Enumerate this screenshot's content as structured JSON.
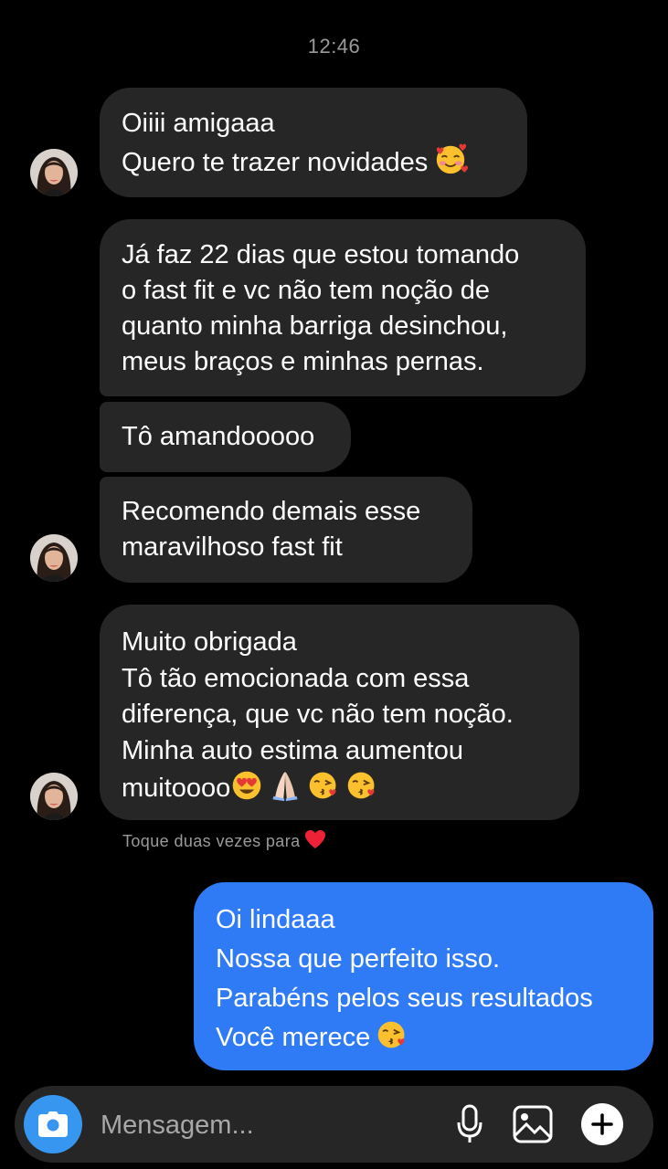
{
  "header": {
    "timestamp": "12:46"
  },
  "messages": [
    {
      "lines": [
        "Oiiii amigaaa",
        "Quero te trazer novidades"
      ],
      "emoji": "smiling-face-with-hearts"
    },
    {
      "lines": [
        "Já faz 22 dias que estou tomando",
        "o fast fit e vc não tem noção de",
        "quanto minha barriga desinchou,",
        "meus braços e minhas pernas."
      ]
    },
    {
      "lines": [
        "Tô amandooooo"
      ]
    },
    {
      "lines": [
        "Recomendo demais esse",
        "maravilhoso fast fit"
      ]
    },
    {
      "lines": [
        "Muito obrigada",
        "Tô tão emocionada com essa",
        "diferença, que vc não tem noção.",
        "Minha auto estima aumentou",
        "muitoooo"
      ],
      "emoji": [
        "heart-eyes",
        "folded-hands",
        "face-blowing-kiss",
        "face-blowing-kiss"
      ]
    },
    {
      "lines": [
        "Oi lindaaa",
        "Nossa que perfeito isso.",
        "Parabéns pelos seus resultados",
        "Você merece"
      ],
      "emoji": "face-blowing-kiss"
    }
  ],
  "hint": {
    "text": "Toque duas vezes para",
    "icon": "heart-icon"
  },
  "composer": {
    "placeholder": "Mensagem..."
  },
  "colors": {
    "background": "#000000",
    "incoming_bubble": "#262626",
    "outgoing_bubble": "#2f7bf5",
    "camera_button": "#3797f0",
    "heart": "#ed2236"
  }
}
